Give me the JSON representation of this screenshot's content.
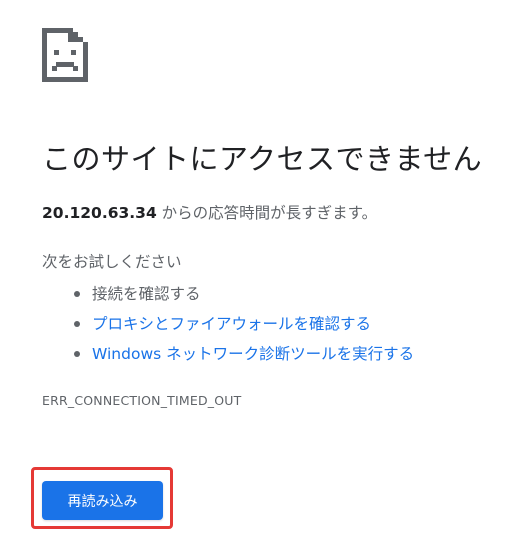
{
  "error_icon": "broken-page-sad-face-icon",
  "title": "このサイトにアクセスできません",
  "message": {
    "host": "20.120.63.34",
    "text": " からの応答時間が長すぎます。"
  },
  "suggestions": {
    "heading": "次をお試しください",
    "items": [
      {
        "label": "接続を確認する",
        "link": false
      },
      {
        "label": "プロキシとファイアウォールを確認する",
        "link": true
      },
      {
        "label": "Windows ネットワーク診断ツールを実行する",
        "link": true
      }
    ]
  },
  "error_code": "ERR_CONNECTION_TIMED_OUT",
  "reload_button": {
    "label": "再読み込み"
  },
  "colors": {
    "accent": "#1a73e8",
    "text": "#202124",
    "secondary_text": "#5f6368",
    "highlight": "#e53935"
  }
}
